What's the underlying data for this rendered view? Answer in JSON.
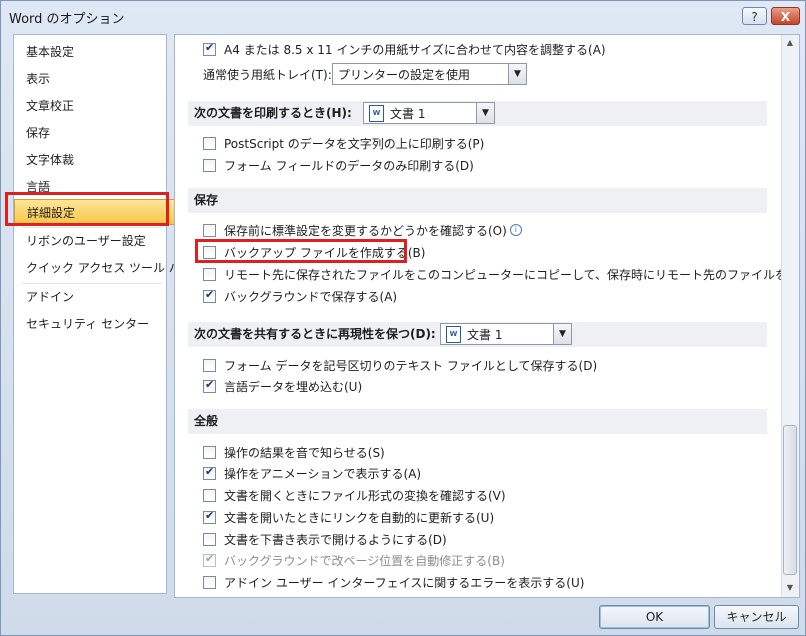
{
  "window": {
    "title": "Word のオプション",
    "help": "?",
    "close": "X"
  },
  "sidebar": {
    "items": [
      "基本設定",
      "表示",
      "文章校正",
      "保存",
      "文字体裁",
      "言語",
      "詳細設定",
      "リボンのユーザー設定",
      "クイック アクセス ツール バー",
      "アドイン",
      "セキュリティ センター"
    ],
    "selected": "詳細設定"
  },
  "content": {
    "top": {
      "a4_label": "A4 または 8.5 x 11 インチの用紙サイズに合わせて内容を調整する(A)",
      "a4_checked": true,
      "tray_label": "通常使う用紙トレイ(T):",
      "tray_value": "プリンターの設定を使用"
    },
    "print_section": {
      "header": "次の文書を印刷するとき(H):",
      "doc_value": "文書 1",
      "items": [
        {
          "label": "PostScript のデータを文字列の上に印刷する(P)",
          "checked": false
        },
        {
          "label": "フォーム フィールドのデータのみ印刷する(D)",
          "checked": false
        }
      ]
    },
    "save_section": {
      "header": "保存",
      "items": [
        {
          "label": "保存前に標準設定を変更するかどうかを確認する(O)",
          "checked": false,
          "info": "i"
        },
        {
          "label": "バックアップ ファイルを作成する(B)",
          "checked": false
        },
        {
          "label": "リモート先に保存されたファイルをこのコンピューターにコピーして、保存時にリモート先のファイルを更新する(E)",
          "checked": false
        },
        {
          "label": "バックグラウンドで保存する(A)",
          "checked": true
        }
      ]
    },
    "share_section": {
      "header": "次の文書を共有するときに再現性を保つ(D):",
      "doc_value": "文書 1",
      "items": [
        {
          "label": "フォーム データを記号区切りのテキスト ファイルとして保存する(D)",
          "checked": false
        },
        {
          "label": "言語データを埋め込む(U)",
          "checked": true
        }
      ]
    },
    "general_section": {
      "header": "全般",
      "items": [
        {
          "label": "操作の結果を音で知らせる(S)",
          "checked": false,
          "disabled": false
        },
        {
          "label": "操作をアニメーションで表示する(A)",
          "checked": true,
          "disabled": false
        },
        {
          "label": "文書を開くときにファイル形式の変換を確認する(V)",
          "checked": false,
          "disabled": false
        },
        {
          "label": "文書を開いたときにリンクを自動的に更新する(U)",
          "checked": true,
          "disabled": false
        },
        {
          "label": "文書を下書き表示で開けるようにする(D)",
          "checked": false,
          "disabled": false
        },
        {
          "label": "バックグラウンドで改ページ位置を自動修正する(B)",
          "checked": true,
          "disabled": true
        },
        {
          "label": "アドイン ユーザー インターフェイスに関するエラーを表示する(U)",
          "checked": false,
          "disabled": false
        }
      ]
    },
    "doc_icon_text": "W"
  },
  "buttons": {
    "ok": "OK",
    "cancel": "キャンセル"
  },
  "colors": {
    "highlight": "#e02020",
    "selected_bg": "#f8c747",
    "section_bg": "#eef0f3"
  }
}
